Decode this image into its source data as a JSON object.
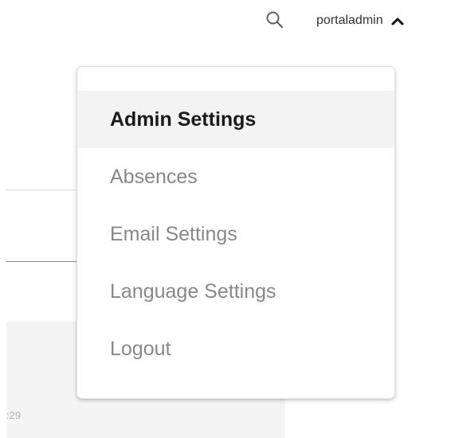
{
  "header": {
    "search_icon": "search-icon",
    "username": "portaladmin",
    "toggle_icon": "chevron-up-icon"
  },
  "menu": {
    "items": [
      {
        "label": "Admin Settings",
        "active": true
      },
      {
        "label": "Absences",
        "active": false
      },
      {
        "label": "Email Settings",
        "active": false
      },
      {
        "label": "Language Settings",
        "active": false
      },
      {
        "label": "Logout",
        "active": false
      }
    ]
  },
  "background": {
    "time_fragment": ":29"
  },
  "colors": {
    "active_text": "#1a1a1a",
    "inactive_text": "#888888",
    "active_bg": "#f3f3f3"
  }
}
